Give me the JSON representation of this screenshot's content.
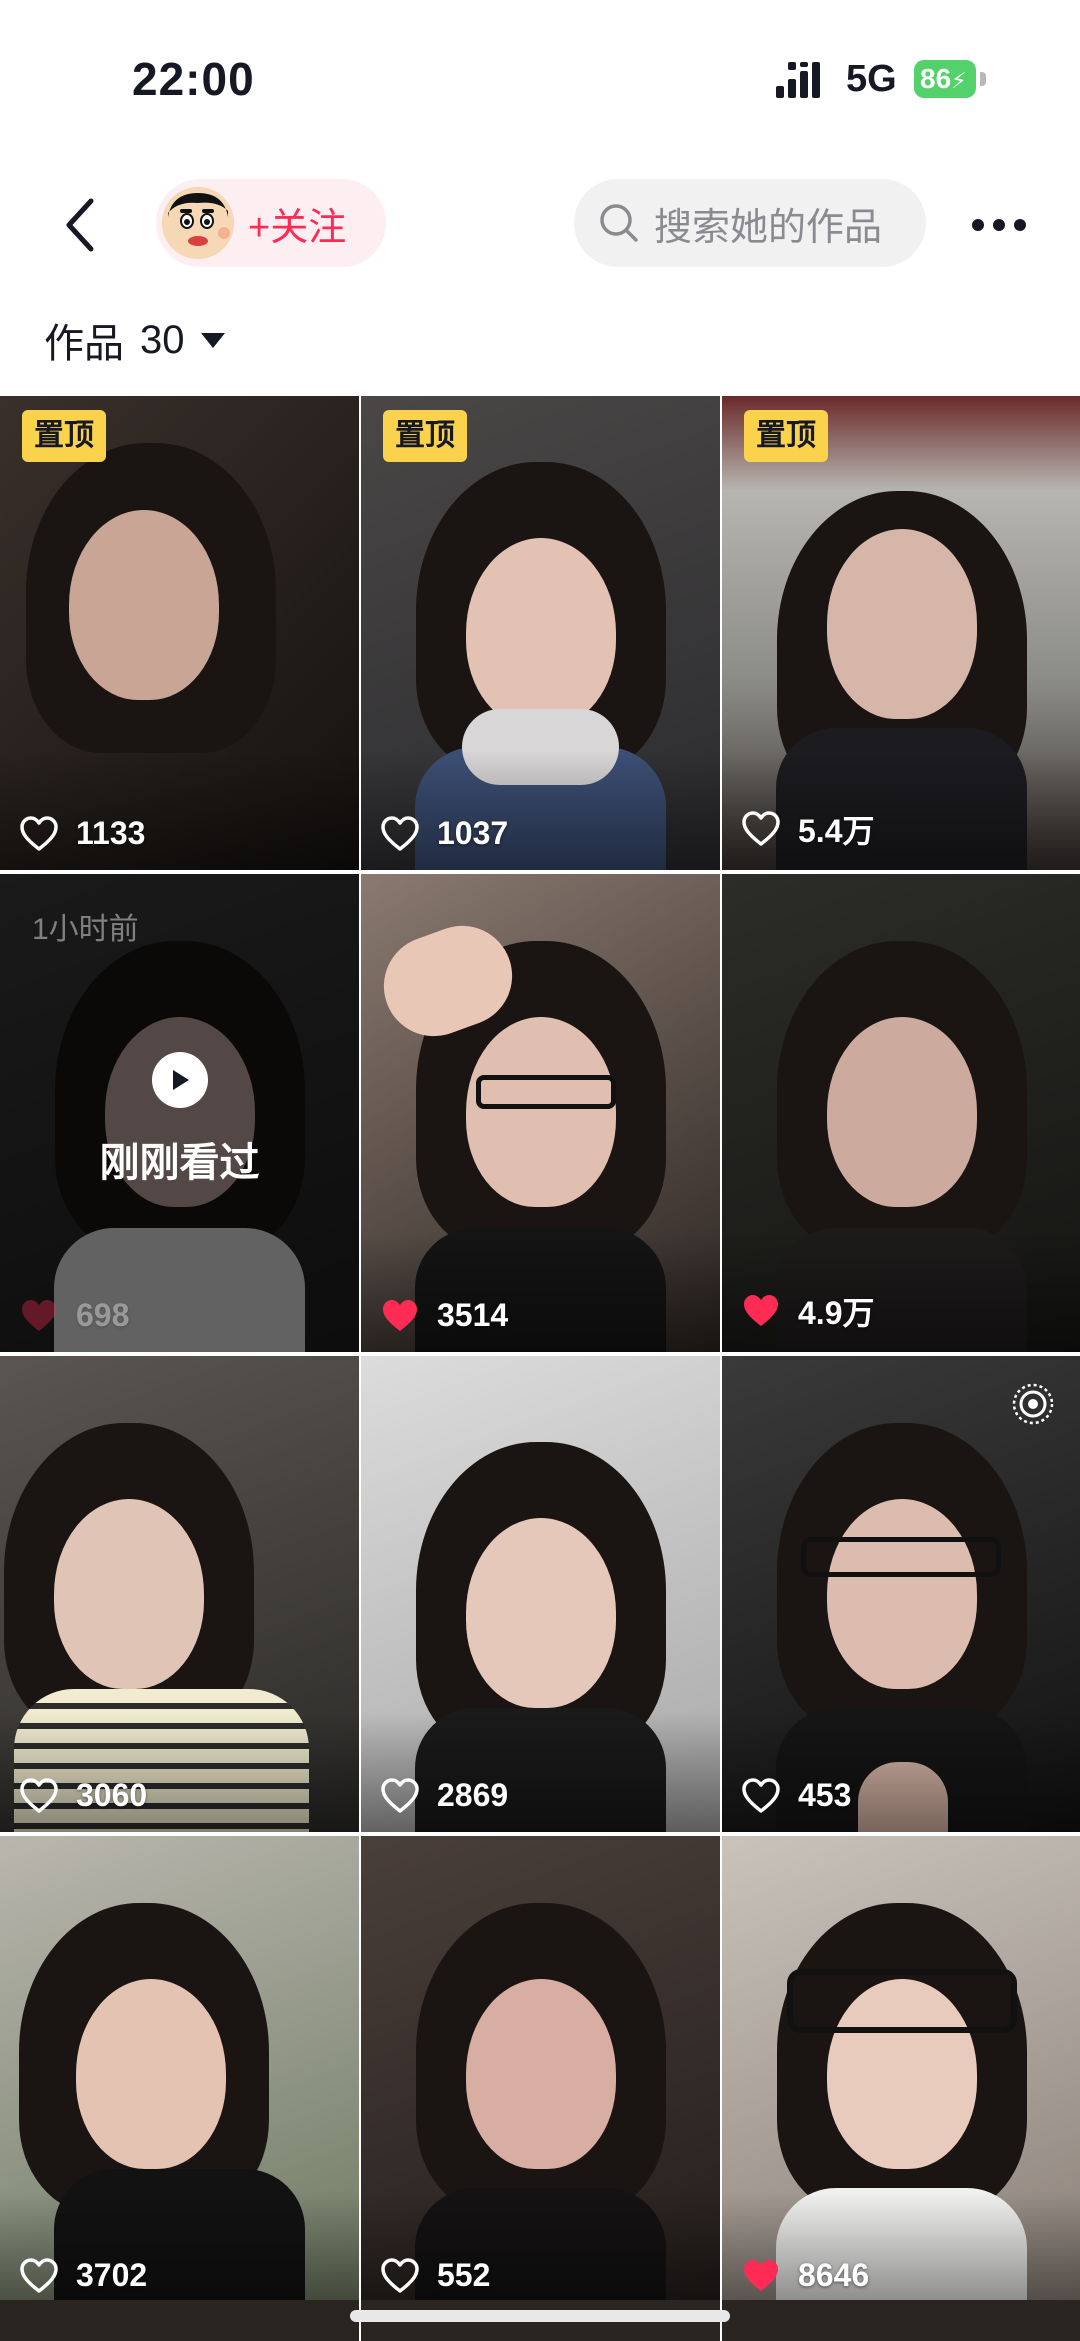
{
  "status_bar": {
    "time": "22:00",
    "network": "5G",
    "battery": "86"
  },
  "header": {
    "follow_label": "+关注",
    "search_placeholder": "搜索她的作品"
  },
  "works": {
    "label": "作品",
    "count": "30"
  },
  "colors": {
    "accent": "#fe2c55",
    "pin_badge": "#fad24b",
    "battery": "#53d16a"
  },
  "videos": [
    {
      "likes": "1133",
      "pinned": "置顶",
      "liked": false
    },
    {
      "likes": "1037",
      "pinned": "置顶",
      "liked": false
    },
    {
      "likes": "5.4万",
      "pinned": "置顶",
      "liked": false
    },
    {
      "likes": "698",
      "liked": true,
      "time_ago": "1小时前",
      "overlay": "刚刚看过"
    },
    {
      "likes": "3514",
      "liked": true
    },
    {
      "likes": "4.9万",
      "liked": true
    },
    {
      "likes": "3060",
      "liked": false
    },
    {
      "likes": "2869",
      "liked": false
    },
    {
      "likes": "453",
      "liked": false,
      "live_icon": "live-photo-icon"
    },
    {
      "likes": "3702",
      "liked": false
    },
    {
      "likes": "552",
      "liked": false
    },
    {
      "likes": "8646",
      "liked": true
    }
  ]
}
